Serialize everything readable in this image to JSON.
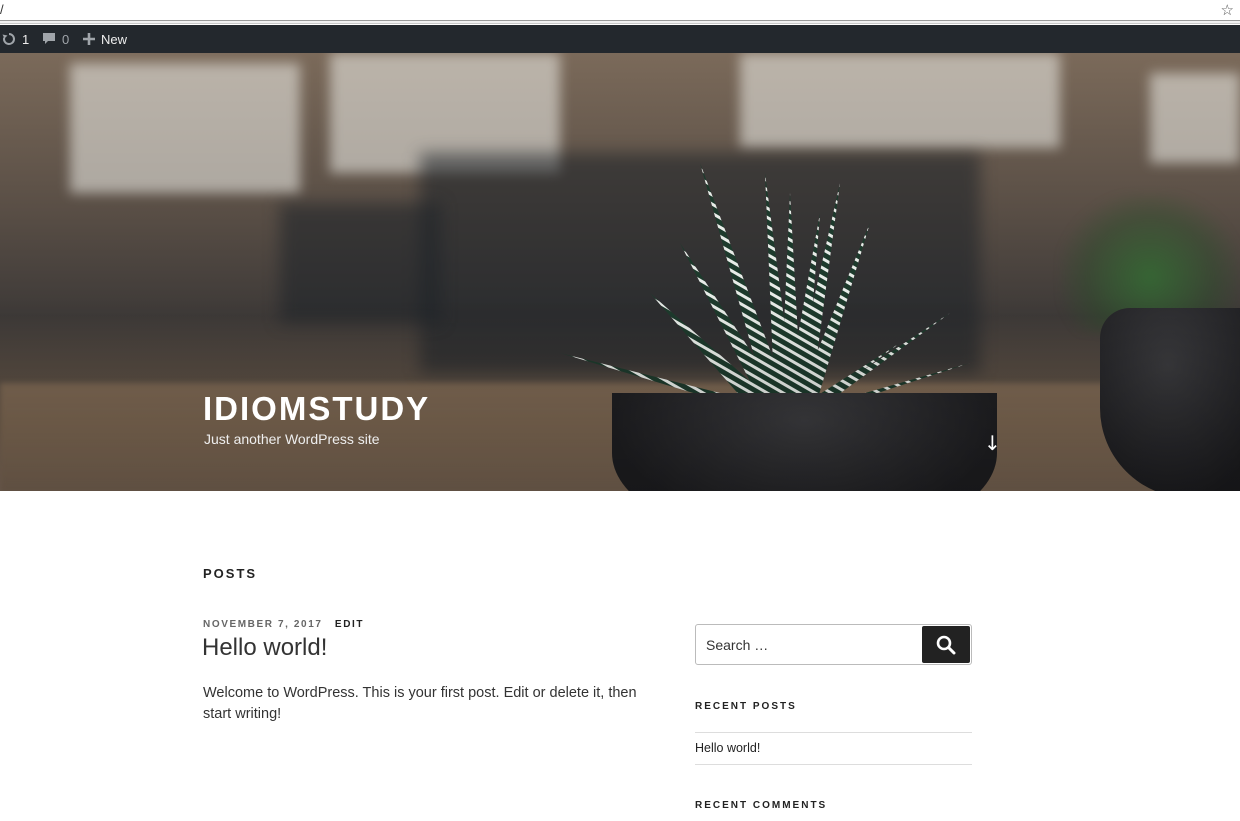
{
  "browser": {
    "address_text": "/",
    "bookmark_icon": "star-icon"
  },
  "admin_bar": {
    "updates_count": "1",
    "comments_count": "0",
    "new_label": "New",
    "icons": [
      "updates-icon",
      "comment-icon",
      "plus-icon"
    ]
  },
  "header": {
    "site_title": "IDIOMSTUDY",
    "tagline": "Just another WordPress site",
    "scroll_icon": "arrow-down-icon"
  },
  "main": {
    "section_title": "POSTS",
    "post": {
      "date": "NOVEMBER 7, 2017",
      "edit_label": "EDIT",
      "title": "Hello world!",
      "excerpt": "Welcome to WordPress. This is your first post. Edit or delete it, then start writing!"
    }
  },
  "sidebar": {
    "search": {
      "placeholder": "Search …",
      "button_icon": "search-icon"
    },
    "recent_posts": {
      "title": "RECENT POSTS",
      "items": [
        "Hello world!"
      ]
    },
    "recent_comments": {
      "title": "RECENT COMMENTS"
    }
  },
  "colors": {
    "admin_bar_bg": "#23282d",
    "search_button_bg": "#222222",
    "text_dark": "#222222"
  }
}
